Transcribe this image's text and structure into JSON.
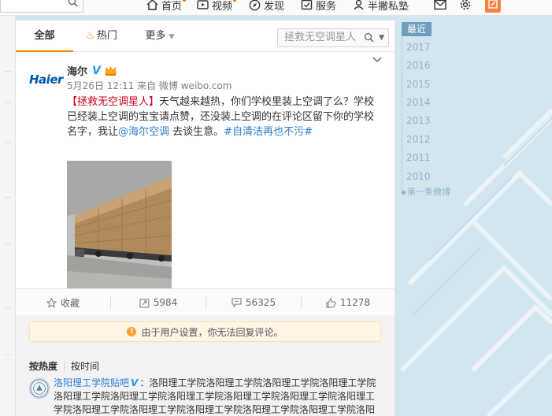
{
  "nav": {
    "items": [
      {
        "label": "首页",
        "icon": "home-icon"
      },
      {
        "label": "视频",
        "icon": "video-icon"
      },
      {
        "label": "发现",
        "icon": "compass-icon"
      },
      {
        "label": "服务",
        "icon": "service-icon"
      },
      {
        "label": "半撇私塾",
        "icon": "user-icon"
      }
    ]
  },
  "tabs": {
    "all": "全部",
    "hot": "热门",
    "more": "更多"
  },
  "search": {
    "placeholder": "拯救无空调星人"
  },
  "post": {
    "author": "海尔",
    "avatar_text": "Haier",
    "meta": "5月26日 12:11 来自 微博 weibo.com",
    "tag": "【拯救无空调星人】",
    "text1": "天气越来越热，你们学校里装上空调了么？学校已经装上空调的宝宝请点赞，还没装上空调的在评论区留下你的学校名字，我让",
    "mention": "@海尔空调",
    "text2": " 去谈生意。",
    "hashtag": "#自清洁再也不污#"
  },
  "actions": {
    "favorite": "收藏",
    "repost": "5984",
    "comment": "56325",
    "like": "11278"
  },
  "notice": "由于用户设置，你无法回复评论。",
  "sort": {
    "hot": "按热度",
    "time": "按时间"
  },
  "comment": {
    "name": "洛阳理工学院贴吧",
    "text": "：洛阳理工学院洛阳理工学院洛阳理工学院洛阳理工学院洛阳理工学院洛阳理工学院洛阳理工学院洛阳理工学院洛阳理工学院洛阳理工学院洛阳理工学院洛阳理工学院洛阳理工学院洛阳理工学院洛阳理工学院洛阳理工学院洛阳理工学院洛阳"
  },
  "timeline": {
    "current": "最近",
    "years": [
      "2017",
      "2016",
      "2015",
      "2014",
      "2013",
      "2012",
      "2011",
      "2010"
    ],
    "first": "第一条微博"
  },
  "colors": {
    "accent": "#ff8200",
    "link": "#2a7fd1",
    "tag": "#d0021b"
  }
}
